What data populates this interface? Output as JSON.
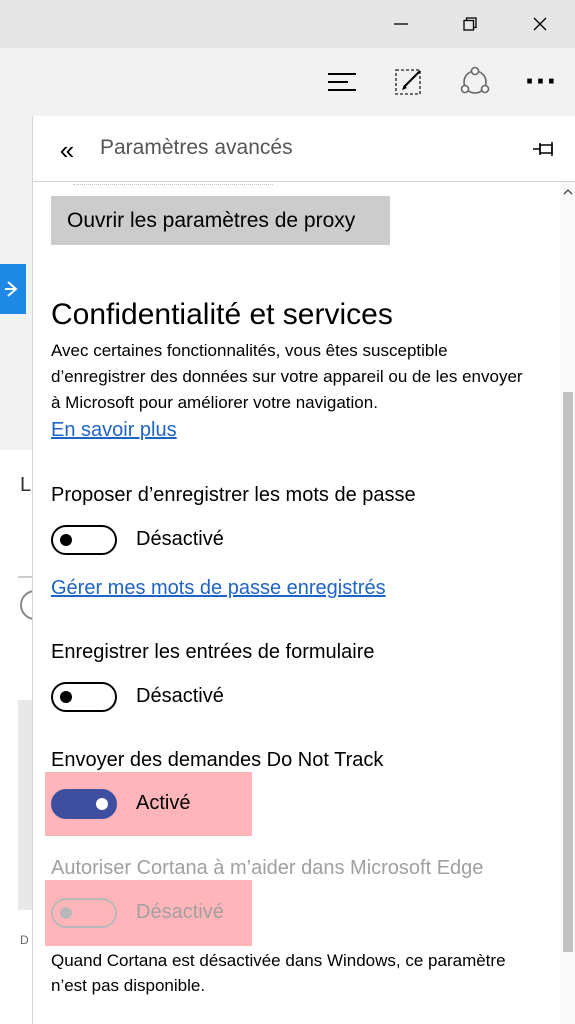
{
  "window": {
    "icons": [
      "minimize-icon",
      "restore-icon",
      "close-icon"
    ]
  },
  "toolbar": {
    "icons": [
      "hub-icon",
      "web-note-icon",
      "share-icon",
      "more-icon"
    ],
    "more_label": "···"
  },
  "background_page": {
    "letter_l": "L",
    "letter_d": "D"
  },
  "panel": {
    "back_label": "«",
    "title": "Paramètres avancés",
    "proxy_button": "Ouvrir les paramètres de proxy",
    "privacy": {
      "title": "Confidentialité et services",
      "description": "Avec certaines fonctionnalités, vous êtes susceptible d’enregistrer des données sur votre appareil ou de les envoyer à Microsoft pour améliorer votre navigation.",
      "learn_more": "En savoir plus"
    },
    "passwords": {
      "label": "Proposer d’enregistrer les mots de passe",
      "state": "Désactivé",
      "is_on": false,
      "manage_link": "Gérer mes mots de passe enregistrés"
    },
    "form_entries": {
      "label": "Enregistrer les entrées de formulaire",
      "state": "Désactivé",
      "is_on": false
    },
    "do_not_track": {
      "label": "Envoyer des demandes Do Not Track",
      "state": "Activé",
      "is_on": true
    },
    "cortana": {
      "label": "Autoriser Cortana à m’aider dans Microsoft Edge",
      "state": "Désactivé",
      "is_on": false,
      "disabled": true,
      "note": "Quand Cortana est désactivée dans Windows, ce paramètre n’est pas disponible."
    }
  },
  "colors": {
    "accent": "#3f4fa0",
    "link": "#1e64c8",
    "highlight": "#ff7882",
    "disabled_text": "#a0a0a0"
  }
}
